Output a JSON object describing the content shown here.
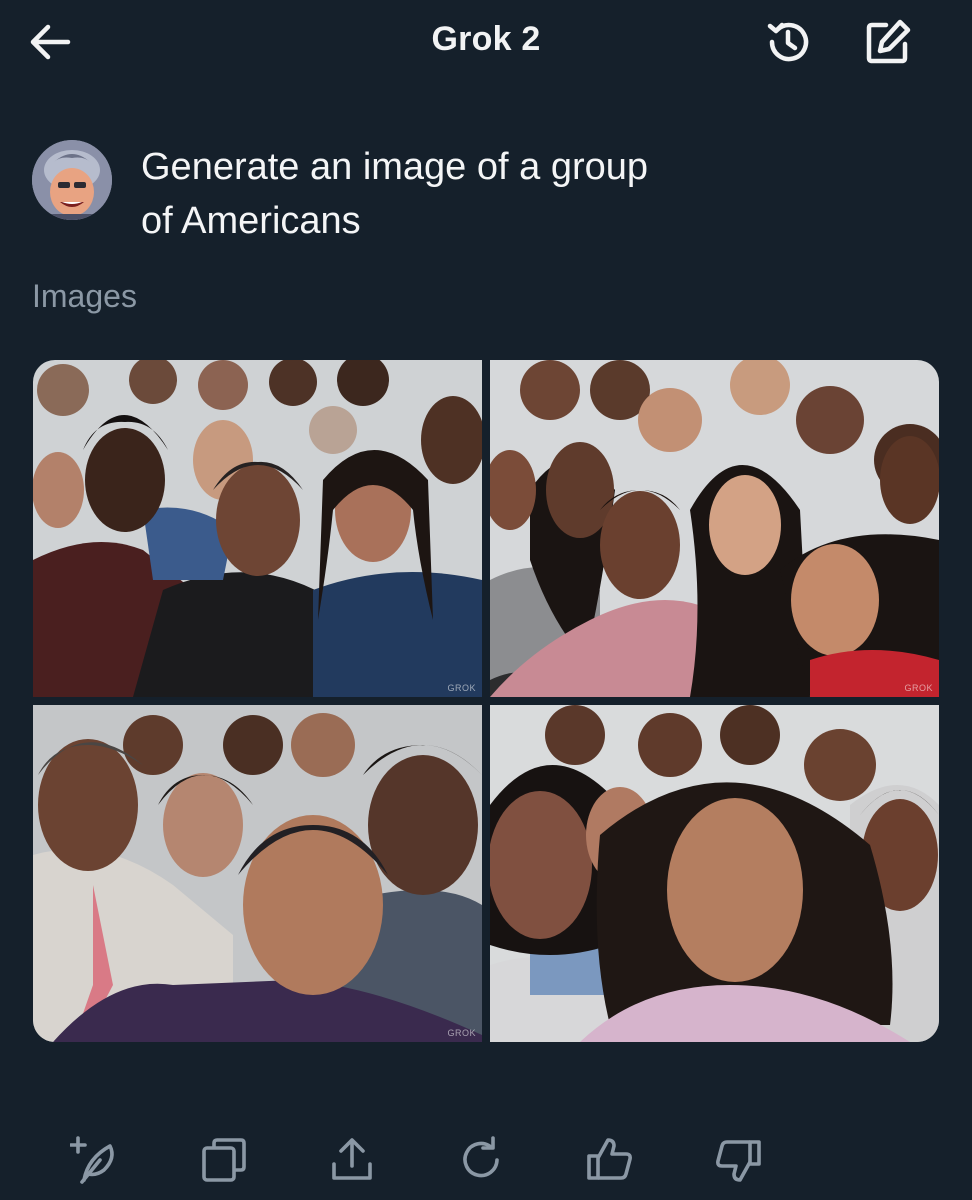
{
  "header": {
    "title": "Grok 2",
    "back_icon": "arrow-left-icon",
    "history_icon": "history-icon",
    "compose_icon": "compose-icon"
  },
  "prompt": {
    "line1": "Generate an image of a group",
    "line2": "of Americans"
  },
  "section_label": "Images",
  "images": {
    "count": 4,
    "watermark": "GROK"
  },
  "actions": [
    {
      "icon": "regenerate-feather-icon"
    },
    {
      "icon": "copy-icon"
    },
    {
      "icon": "share-icon"
    },
    {
      "icon": "refresh-icon"
    },
    {
      "icon": "thumbs-up-icon"
    },
    {
      "icon": "thumbs-down-icon"
    }
  ],
  "colors": {
    "background": "#15202b",
    "text": "#e7e9ea",
    "muted": "#8b98a5"
  }
}
